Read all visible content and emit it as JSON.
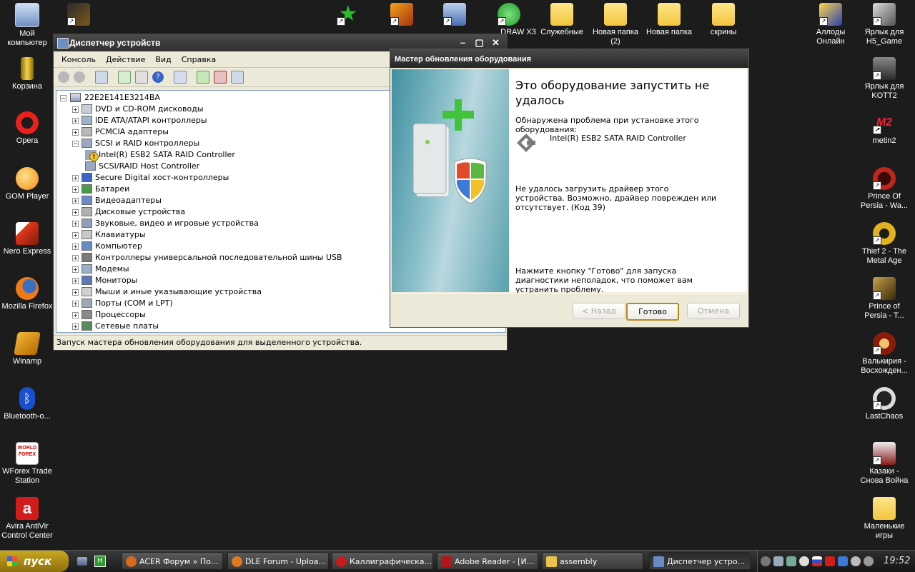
{
  "desktop": {
    "left_icons": [
      {
        "label": "Мой компьютер"
      },
      {
        "label": "Корзина"
      },
      {
        "label": "Opera"
      },
      {
        "label": "GOM Player"
      },
      {
        "label": "Nero Express"
      },
      {
        "label": "Mozilla Firefox"
      },
      {
        "label": "Winamp"
      },
      {
        "label": "Bluetooth-о..."
      },
      {
        "label": "WForex Trade Station"
      },
      {
        "label": "Avira AntiVir Control Center"
      }
    ],
    "top_icons": [
      {
        "label": "Служебные"
      },
      {
        "label": "Новая папка (2)"
      },
      {
        "label": "Новая папка"
      },
      {
        "label": "скрины"
      }
    ],
    "partial_top": {
      "coreldraw": "DRAW X3"
    },
    "right_icons": [
      {
        "label": "Аллоды Онлайн"
      },
      {
        "label": "Ярлык для H5_Game"
      },
      {
        "label": "Ярлык для KOTT2"
      },
      {
        "label": "metin2"
      },
      {
        "label": "Prince Of Persia - Wa..."
      },
      {
        "label": "Thief 2 - The Metal Age"
      },
      {
        "label": "Prince of Persia - T..."
      },
      {
        "label": "Валькирия - Восхожден..."
      },
      {
        "label": "LastChaos"
      },
      {
        "label": "Казаки - Снова Война"
      },
      {
        "label": "Маленькие игры"
      }
    ]
  },
  "devmgr": {
    "title": "Диспетчер устройств",
    "menu": [
      "Консоль",
      "Действие",
      "Вид",
      "Справка"
    ],
    "root": "22E2E141E3214BA",
    "tree": [
      {
        "label": "DVD и CD-ROM дисководы",
        "level": 1,
        "expand": "+"
      },
      {
        "label": "IDE ATA/ATAPI контроллеры",
        "level": 1,
        "expand": "+"
      },
      {
        "label": "PCMCIA адаптеры",
        "level": 1,
        "expand": "+"
      },
      {
        "label": "SCSI и RAID контроллеры",
        "level": 1,
        "expand": "−"
      },
      {
        "label": "Intel(R) ESB2 SATA RAID Controller",
        "level": 2,
        "expand": "",
        "warn": true
      },
      {
        "label": "SCSI/RAID Host Controller",
        "level": 2,
        "expand": ""
      },
      {
        "label": "Secure Digital хост-контроллеры",
        "level": 1,
        "expand": "+"
      },
      {
        "label": "Батареи",
        "level": 1,
        "expand": "+"
      },
      {
        "label": "Видеоадаптеры",
        "level": 1,
        "expand": "+"
      },
      {
        "label": "Дисковые устройства",
        "level": 1,
        "expand": "+"
      },
      {
        "label": "Звуковые, видео и игровые устройства",
        "level": 1,
        "expand": "+"
      },
      {
        "label": "Клавиатуры",
        "level": 1,
        "expand": "+"
      },
      {
        "label": "Компьютер",
        "level": 1,
        "expand": "+"
      },
      {
        "label": "Контроллеры универсальной последовательной шины USB",
        "level": 1,
        "expand": "+"
      },
      {
        "label": "Модемы",
        "level": 1,
        "expand": "+"
      },
      {
        "label": "Мониторы",
        "level": 1,
        "expand": "+"
      },
      {
        "label": "Мыши и иные указывающие устройства",
        "level": 1,
        "expand": "+"
      },
      {
        "label": "Порты (COM и LPT)",
        "level": 1,
        "expand": "+"
      },
      {
        "label": "Процессоры",
        "level": 1,
        "expand": "+"
      },
      {
        "label": "Сетевые платы",
        "level": 1,
        "expand": "+"
      }
    ],
    "status": "Запуск мастера обновления оборудования для выделенного устройства."
  },
  "wizard": {
    "title": "Мастер обновления оборудования",
    "heading": "Это оборудование запустить не удалось",
    "problem_text": "Обнаружена проблема при установке этого оборудования:",
    "device_name": "Intel(R) ESB2 SATA RAID Controller",
    "error_text": "Не удалось загрузить драйвер этого устройства. Возможно, драйвер поврежден или отсутствует. (Код 39)",
    "hint_text": "Нажмите кнопку \"Готово\" для запуска диагностики неполадок, что поможет вам устранить проблему.",
    "back_label": "< Назад",
    "finish_label": "Готово",
    "cancel_label": "Отмена"
  },
  "taskbar": {
    "start_label": "пуск",
    "tasks": [
      {
        "label": "ACER Форум » По...",
        "color": "#d66b1c"
      },
      {
        "label": "DLE Forum - Uploa...",
        "color": "#e07a21"
      },
      {
        "label": "Каллиграфическа...",
        "color": "#cc1a1a"
      },
      {
        "label": "Adobe Reader - [И...",
        "color": "#b3161a"
      },
      {
        "label": "assembly",
        "color": "#e9c34a"
      },
      {
        "label": "Диспетчер устро...",
        "color": "#6a8bc2"
      }
    ],
    "clock": "19:52"
  }
}
